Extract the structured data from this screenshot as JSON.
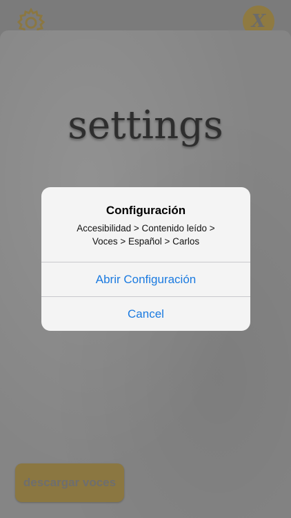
{
  "header": {
    "settings_icon": "gear-icon",
    "close_icon": "close-icon",
    "close_glyph": "X"
  },
  "panel": {
    "title": "settings",
    "download_button_label": "descargar voces"
  },
  "alert": {
    "title": "Configuración",
    "message_line1": "Accesibilidad > Contenido leído >",
    "message_line2": "Voces > Español > Carlos",
    "primary_action": "Abrir Configuración",
    "cancel_action": "Cancel"
  },
  "colors": {
    "accent_gold": "#8b7741",
    "alert_button_blue": "#1a7ae0",
    "dim_overlay_gray": "#858585"
  }
}
